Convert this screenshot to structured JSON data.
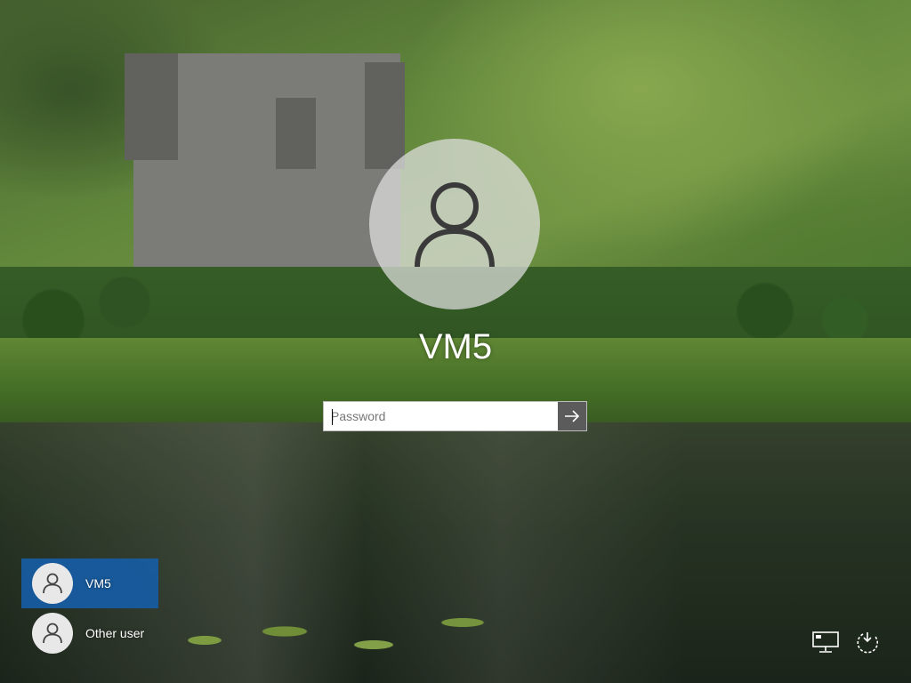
{
  "user": {
    "name": "VM5",
    "avatar_icon": "user-icon"
  },
  "password": {
    "placeholder": "Password",
    "value": "",
    "submit_icon": "arrow-right-icon"
  },
  "user_list": [
    {
      "label": "VM5",
      "selected": true,
      "icon": "user-icon"
    },
    {
      "label": "Other user",
      "selected": false,
      "icon": "user-icon"
    }
  ],
  "corner_icons": {
    "network": "network-icon",
    "power": "power-icon"
  },
  "colors": {
    "selected_user": "#1e5fa0",
    "submit_button": "#5b5b5b"
  }
}
